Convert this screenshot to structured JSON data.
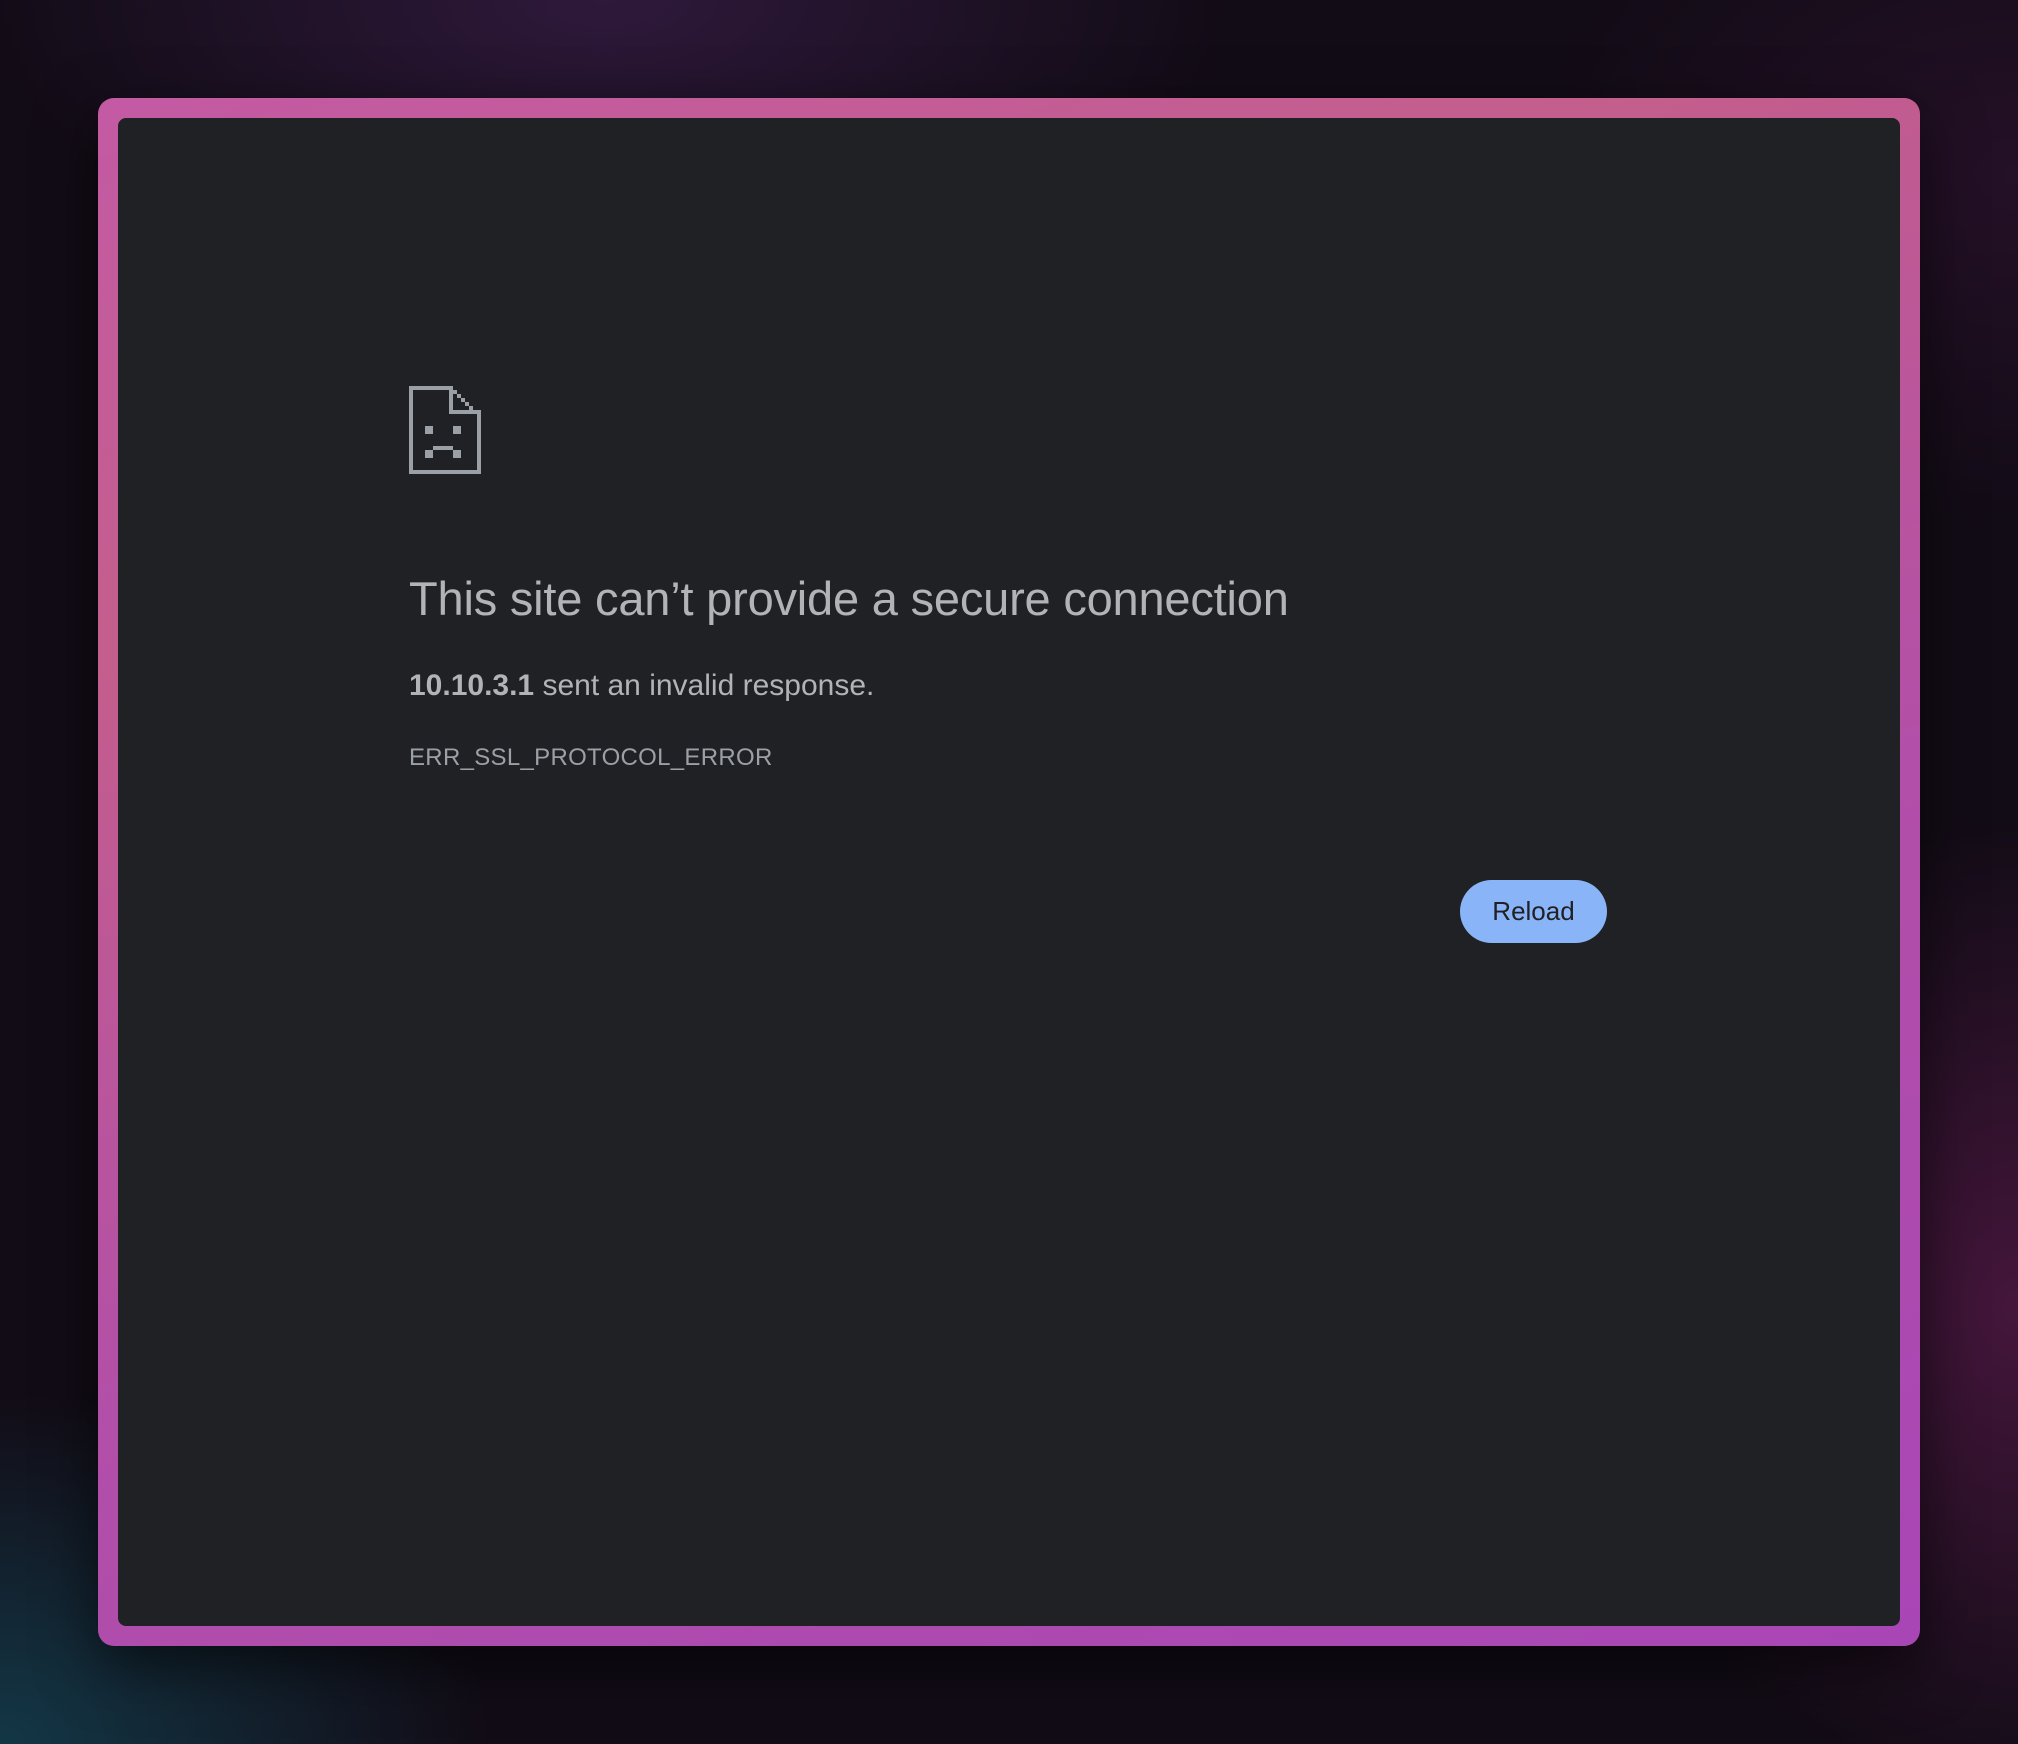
{
  "error_page": {
    "icon": "sad-page-icon",
    "headline": "This site can’t provide a secure connection",
    "message": {
      "host": "10.10.3.1",
      "text": " sent an invalid response."
    },
    "error_code": "ERR_SSL_PROTOCOL_ERROR",
    "reload_label": "Reload"
  },
  "colors": {
    "page_background": "#202124",
    "text": "#b1b3b6",
    "button": "#8ab4f8",
    "frame_border": "#b24fa8"
  }
}
